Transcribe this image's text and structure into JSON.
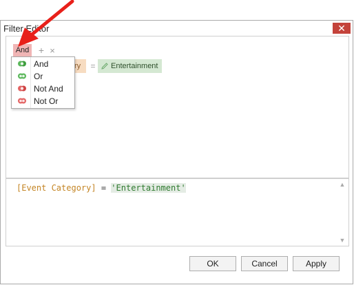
{
  "window": {
    "title": "Filter Editor",
    "close_glyph": "✕"
  },
  "filter": {
    "group_label": "And",
    "field_partial": "ry",
    "operator": "=",
    "value": "Entertainment"
  },
  "group_menu": {
    "items": [
      {
        "label": "And",
        "icon": "and-group-icon",
        "color": "#4caf50"
      },
      {
        "label": "Or",
        "icon": "or-group-icon",
        "color": "#4caf50"
      },
      {
        "label": "Not And",
        "icon": "not-and-group-icon",
        "color": "#e05050"
      },
      {
        "label": "Not Or",
        "icon": "not-or-group-icon",
        "color": "#e05050"
      }
    ]
  },
  "expression": {
    "field": "[Event Category]",
    "operator": "=",
    "value": "'Entertainment'"
  },
  "buttons": {
    "ok": "OK",
    "cancel": "Cancel",
    "apply": "Apply"
  },
  "colors": {
    "accent_red": "#c4433b",
    "annotation_arrow": "#e8201a"
  }
}
